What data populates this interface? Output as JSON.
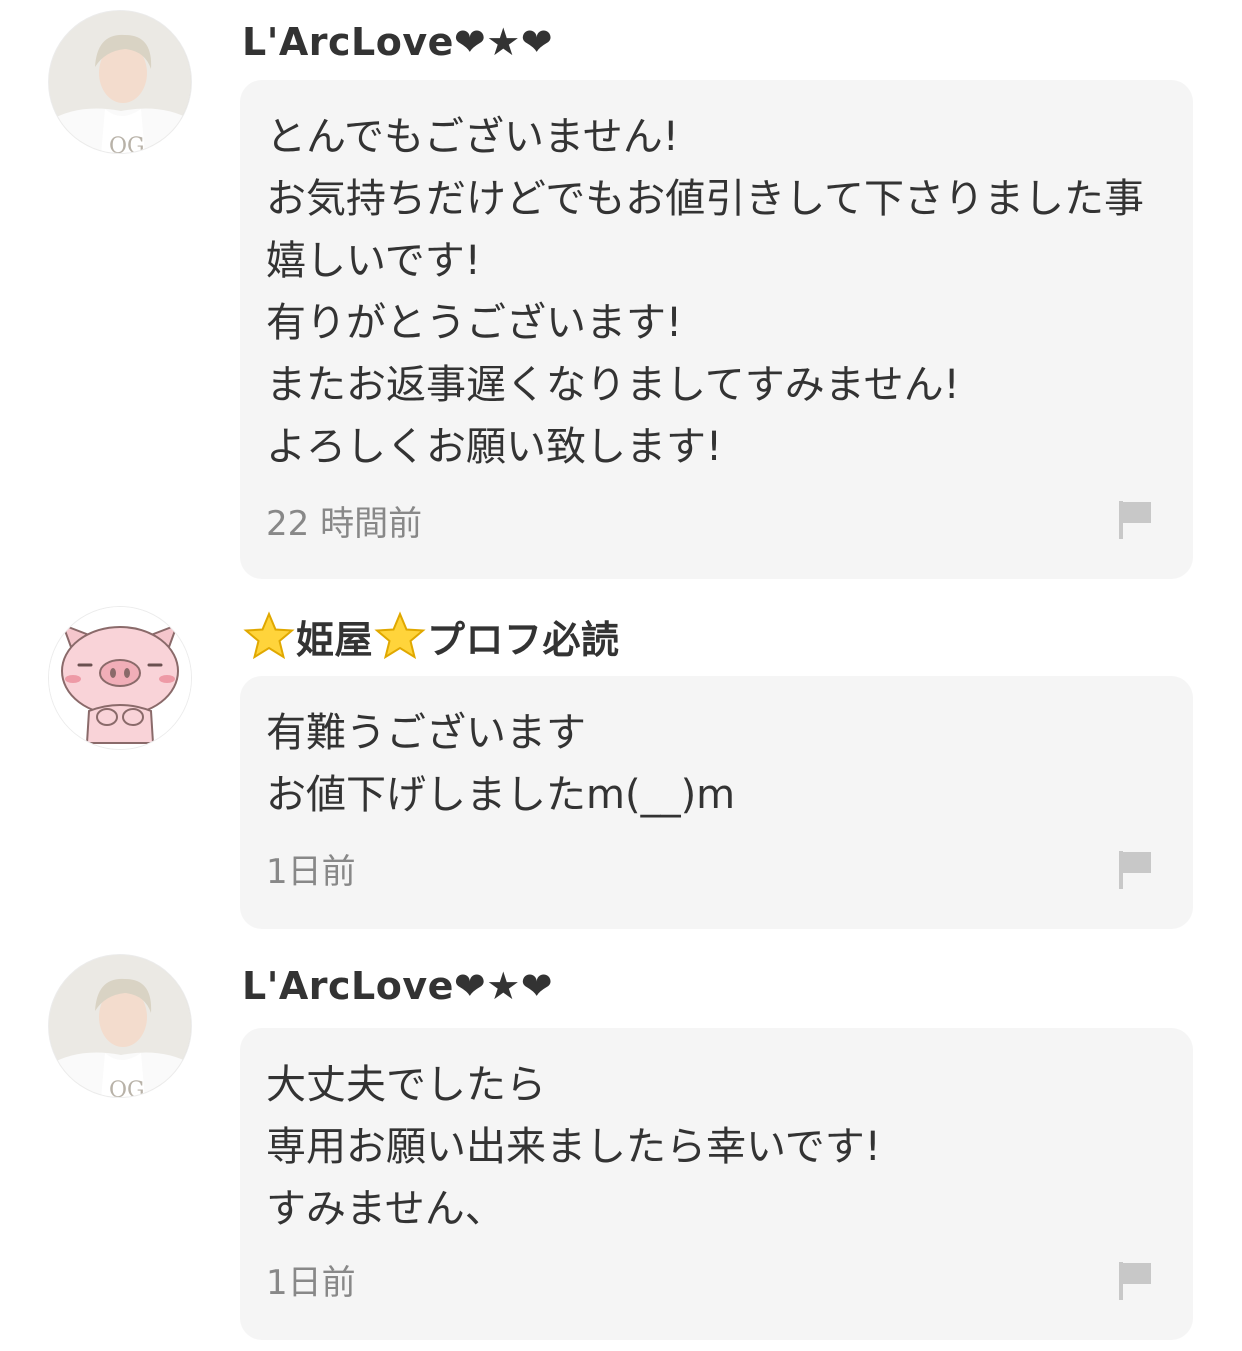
{
  "comments": [
    {
      "username": "L'ArcLove❤★❤",
      "message": "とんでもございません!\nお気持ちだけどでもお値引きして下さりました事嬉しいです!\n有りがとうございます!\nまたお返事遅くなりましてすみません!\nよろしくお願い致します!",
      "time": "22 時間前",
      "avatar": "person-photo"
    },
    {
      "username_parts": [
        "⭐",
        "姫屋",
        "⭐",
        "プロフ必読"
      ],
      "message": "有難うございます\nお値下げしましたm(__)m",
      "time": "1日前",
      "avatar": "pig-illustration"
    },
    {
      "username": "L'ArcLove❤★❤",
      "message": "大丈夫でしたら\n専用お願い出来ましたら幸いです!\nすみません、",
      "time": "1日前",
      "avatar": "person-photo"
    }
  ],
  "icons": {
    "report": "flag-icon"
  },
  "colors": {
    "bubble": "#f5f5f5",
    "text": "#333333",
    "timestamp": "#888888",
    "flag": "#c8c8c8"
  }
}
